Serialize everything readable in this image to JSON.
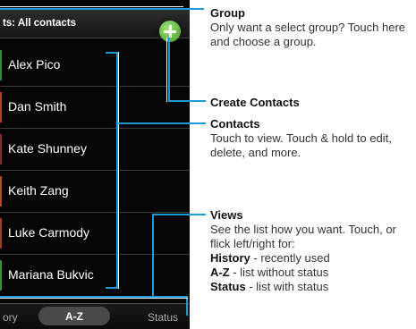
{
  "phone": {
    "header_title": "ts: All contacts",
    "contacts": [
      {
        "name": "Alex Pico",
        "stripe": "#2e8b3a"
      },
      {
        "name": "Dan Smith",
        "stripe": "#c23a2a"
      },
      {
        "name": "Kate Shunney",
        "stripe": "#8a2f2f"
      },
      {
        "name": "Keith Zang",
        "stripe": "#b44a2a"
      },
      {
        "name": "Luke Carmody",
        "stripe": "#a33a2a"
      },
      {
        "name": "Mariana Bukvic",
        "stripe": "#3a8f3a"
      }
    ],
    "tabs": {
      "history": "ory",
      "az": "A-Z",
      "status": "Status"
    }
  },
  "annotations": {
    "group": {
      "heading": "Group",
      "text": "Only want a select group? Touch here and choose a group."
    },
    "create": {
      "heading": "Create Contacts"
    },
    "contacts": {
      "heading": "Contacts",
      "text": "Touch to view. Touch & hold to edit, delete, and more."
    },
    "views": {
      "heading": "Views",
      "text": "See the list how you want. Touch, or flick left/right for:",
      "items": [
        {
          "key": "History",
          "desc": " - recently used"
        },
        {
          "key": "A-Z",
          "desc": " - list without status"
        },
        {
          "key": "Status",
          "desc": " - list with status"
        }
      ]
    }
  },
  "accent_color": "#1a9ad6"
}
